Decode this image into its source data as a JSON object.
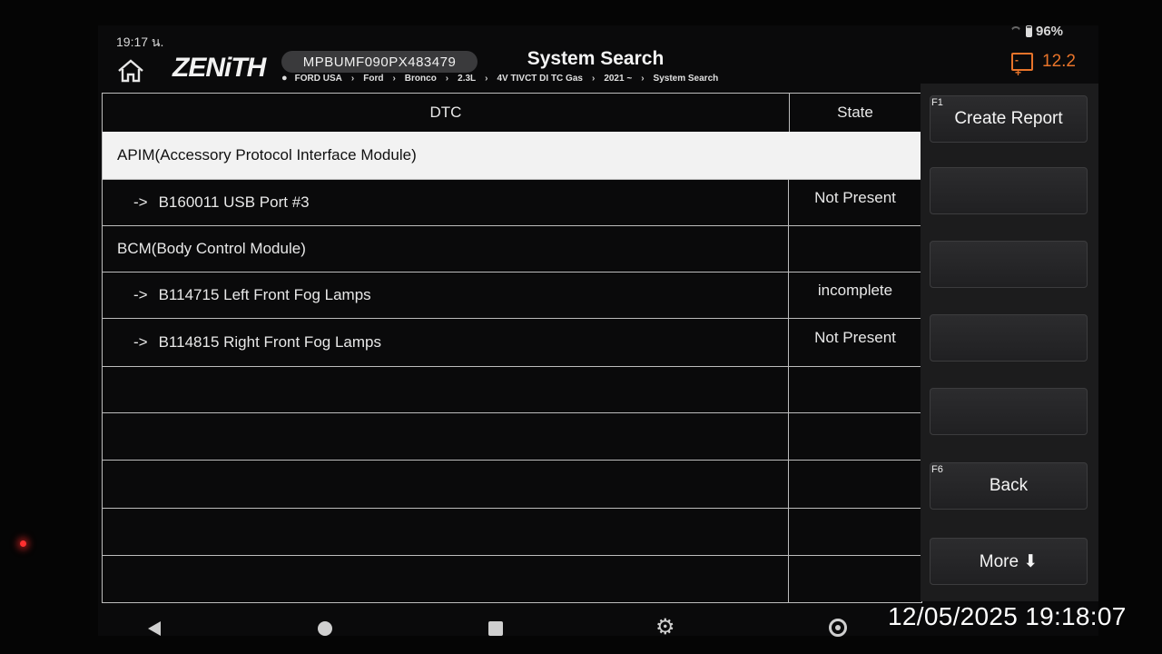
{
  "status": {
    "time": "19:17 น.",
    "battery": "96%"
  },
  "header": {
    "logo": "ZENiTH",
    "vin": "MPBUMF090PX483479",
    "title": "System Search",
    "breadcrumb": [
      "FORD USA",
      "Ford",
      "Bronco",
      "2.3L",
      "4V TIVCT DI TC Gas",
      "2021 ~",
      "System Search"
    ],
    "voltage": "12.2"
  },
  "table": {
    "col_dtc": "DTC",
    "col_state": "State",
    "rows": [
      {
        "kind": "module",
        "text": "APIM(Accessory Protocol Interface Module)",
        "state": "",
        "selected": true
      },
      {
        "kind": "dtc",
        "arrow": "->",
        "text": "B160011 USB Port #3",
        "state": "Not Present"
      },
      {
        "kind": "module",
        "text": "BCM(Body Control Module)",
        "state": ""
      },
      {
        "kind": "dtc",
        "arrow": "->",
        "text": "B114715 Left Front Fog Lamps",
        "state": "incomplete"
      },
      {
        "kind": "dtc",
        "arrow": "->",
        "text": "B114815 Right Front Fog Lamps",
        "state": "Not Present"
      },
      {
        "kind": "empty",
        "text": "",
        "state": ""
      },
      {
        "kind": "empty",
        "text": "",
        "state": ""
      },
      {
        "kind": "empty",
        "text": "",
        "state": ""
      },
      {
        "kind": "empty",
        "text": "",
        "state": ""
      },
      {
        "kind": "empty",
        "text": "",
        "state": ""
      }
    ]
  },
  "side_buttons": [
    {
      "key": "F1",
      "label": "Create Report"
    },
    {
      "key": "",
      "label": ""
    },
    {
      "key": "",
      "label": ""
    },
    {
      "key": "",
      "label": ""
    },
    {
      "key": "",
      "label": ""
    },
    {
      "key": "F6",
      "label": "Back"
    },
    {
      "key": "",
      "label": "More ⬇"
    }
  ],
  "timestamp": "12/05/2025 19:18:07",
  "icons": [
    "home-icon",
    "location-pin-icon",
    "car-battery-icon",
    "nav-back-icon",
    "nav-home-icon",
    "nav-recents-icon",
    "settings-gear-icon",
    "browser-icon",
    "wifi-icon",
    "battery-icon"
  ],
  "colors": {
    "accent": "#e8742a",
    "selected_row": "#f2f2f2",
    "background": "#0a0a0b"
  }
}
